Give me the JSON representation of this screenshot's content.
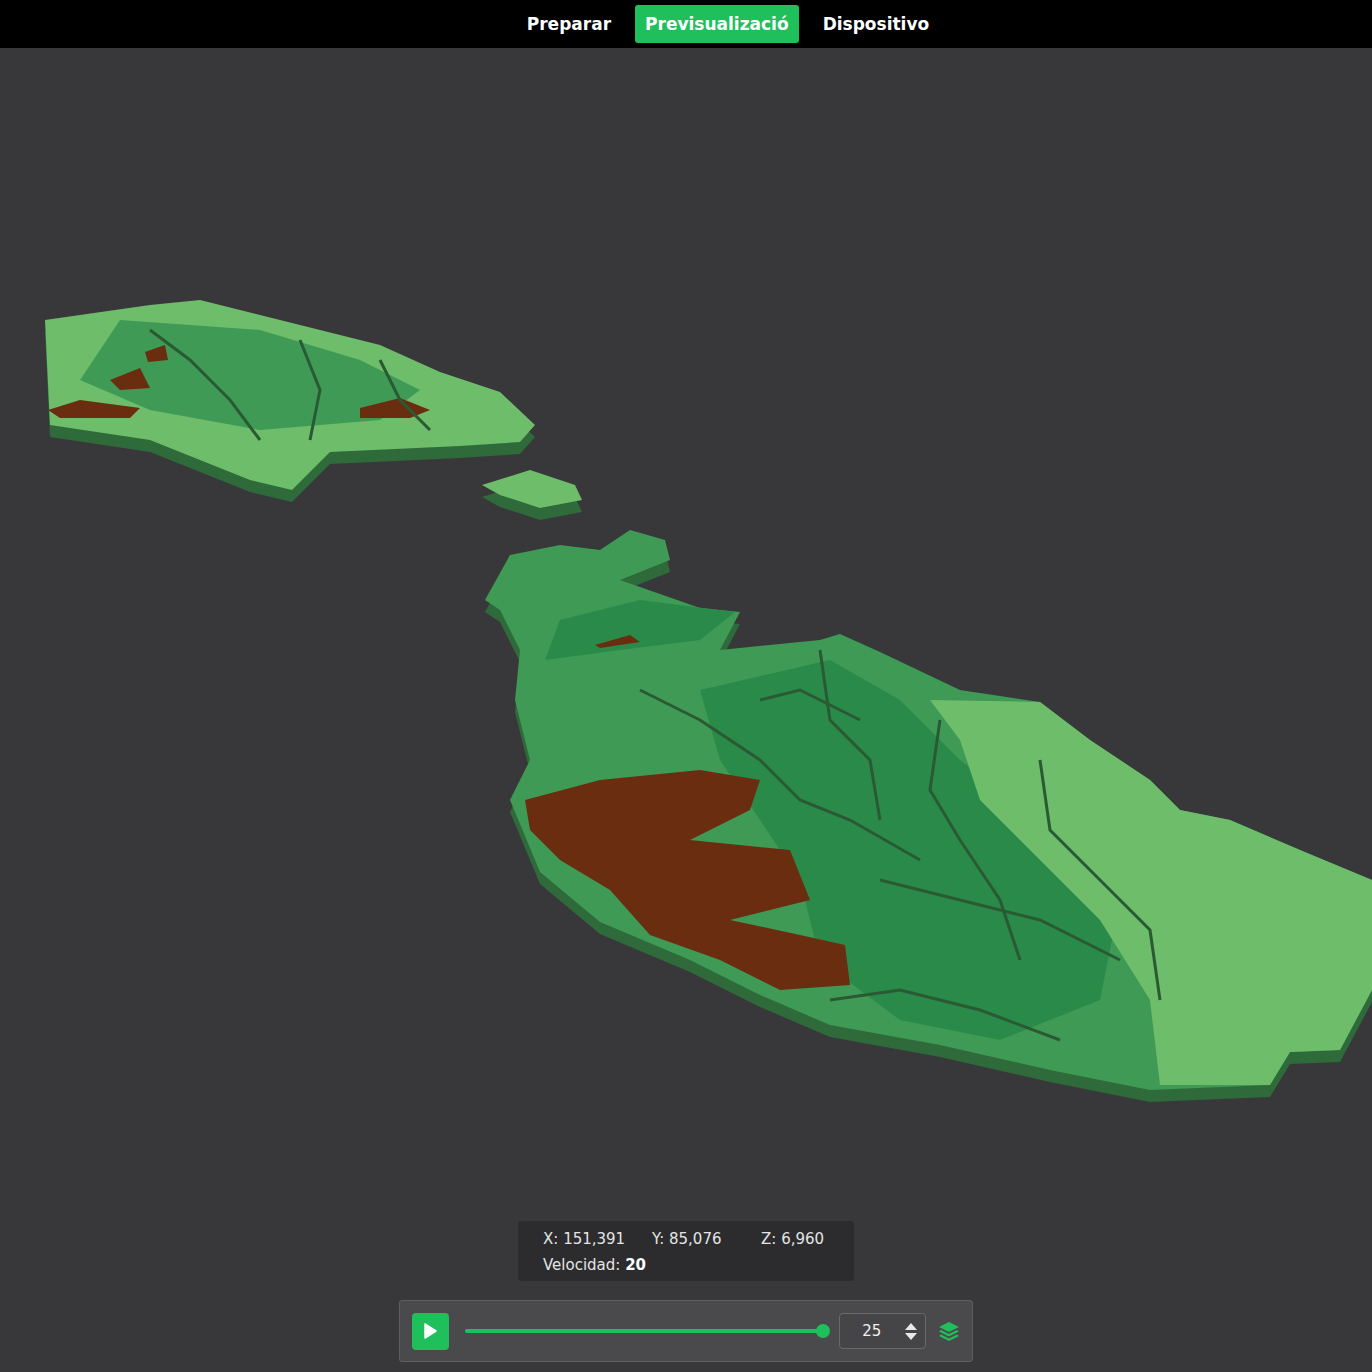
{
  "tabs": [
    {
      "label": "Preparar",
      "selected": false
    },
    {
      "label": "Previsualizació",
      "selected": true
    },
    {
      "label": "Dispositivo",
      "selected": false
    }
  ],
  "coordinates": [
    {
      "axis": "X:",
      "value": "151,391"
    },
    {
      "axis": "Y:",
      "value": "85,076"
    },
    {
      "axis": "Z:",
      "value": "6,960"
    }
  ],
  "speed": {
    "label": "Velocidad:",
    "value": "20"
  },
  "layer_slider": {
    "level": 1.0
  },
  "layer_input": {
    "value": "25"
  }
}
